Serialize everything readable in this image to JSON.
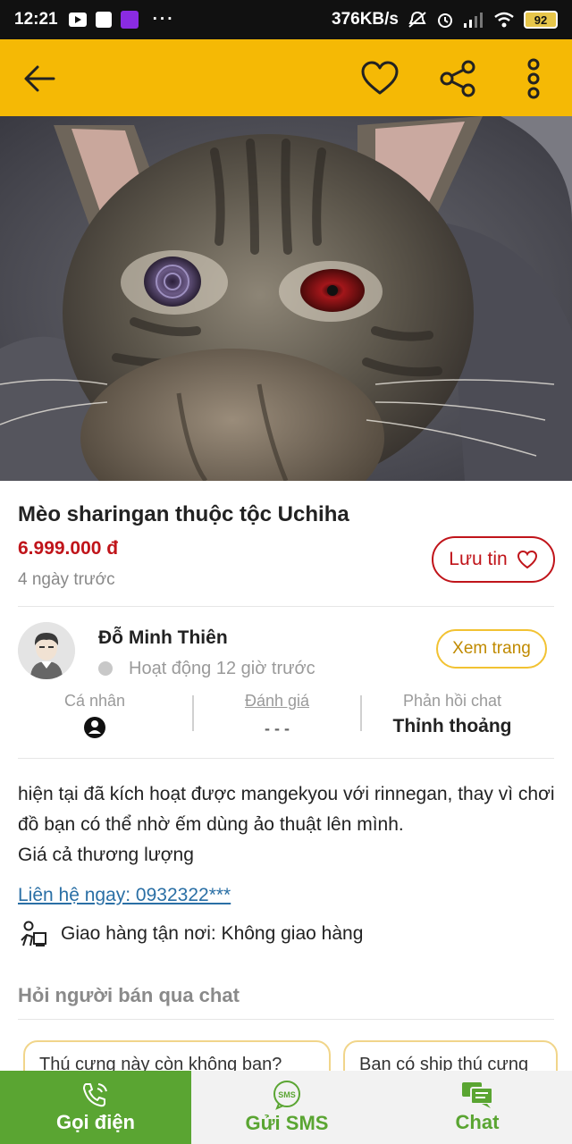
{
  "status_bar": {
    "time": "12:21",
    "net_speed": "376KB/s",
    "battery": "92",
    "more": "···"
  },
  "app_bar": {
    "color": "#f5b905",
    "icons": [
      "back-arrow-icon",
      "heart-icon",
      "share-icon",
      "more-vertical-icon"
    ]
  },
  "listing": {
    "title": "Mèo sharingan thuộc tộc Uchiha",
    "price": "6.999.000 đ",
    "posted": "4 ngày trước",
    "save_label": "Lưu tin"
  },
  "seller": {
    "name": "Đỗ Minh Thiên",
    "activity": "Hoạt động 12 giờ trước",
    "view_label": "Xem trang",
    "stats": [
      {
        "label": "Cá nhân",
        "value": ""
      },
      {
        "label": "Đánh giá",
        "value": "- - -"
      },
      {
        "label": "Phản hồi chat",
        "value": "Thỉnh thoảng"
      }
    ]
  },
  "description": {
    "line1": "hiện tại đã kích hoạt được mangekyou với rinnegan, thay vì chơi đồ bạn có thể nhờ ếm dùng ảo thuật lên mình.",
    "line2": "Giá cả thương lượng",
    "contact": "Liên hệ ngay: 0932322***",
    "delivery": "Giao hàng tận nơi: Không giao hàng"
  },
  "chat": {
    "heading": "Hỏi người bán qua chat",
    "chips": [
      "Thú cưng này còn không bạn?",
      "Bạn có ship thú cưng"
    ]
  },
  "bottom_nav": {
    "call": "Gọi điện",
    "sms": "Gửi SMS",
    "sms_icon_text": "SMS",
    "chat": "Chat",
    "accent": "#5aa532"
  }
}
